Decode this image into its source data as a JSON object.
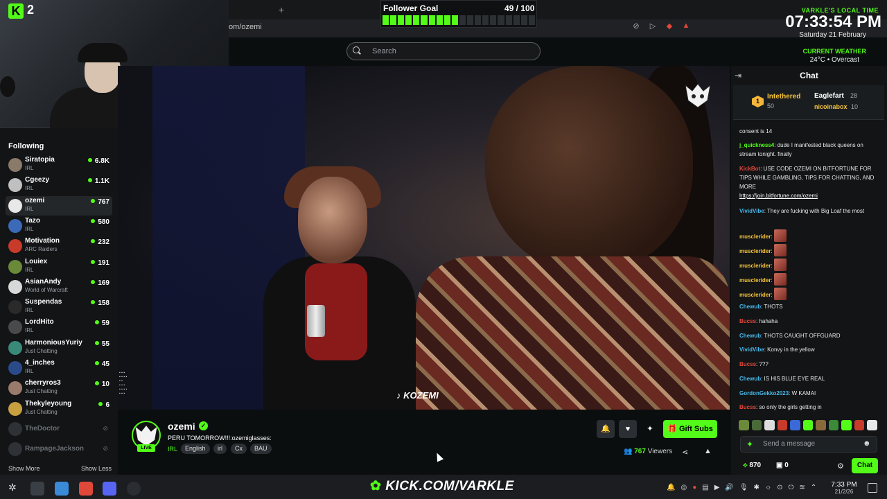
{
  "browser": {
    "url": "om/ozemi",
    "new_tab": "+"
  },
  "header": {
    "search_placeholder": "Search"
  },
  "overlay": {
    "badge_number": "2",
    "goal_title": "Follower Goal",
    "goal_count": "49 / 100",
    "goal_progress": 0.49,
    "time_label": "VARKLE'S LOCAL TIME",
    "time": "07:33:54 PM",
    "date": "Saturday 21 February",
    "weather_label": "CURRENT WEATHER",
    "weather": "24°C • Overcast"
  },
  "sidebar": {
    "title": "Following",
    "items": [
      {
        "name": "Siratopia",
        "category": "IRL",
        "viewers": "6.8K",
        "color": "#8a7a6a"
      },
      {
        "name": "Cgeezy",
        "category": "IRL",
        "viewers": "1.1K",
        "color": "#c0c0c0"
      },
      {
        "name": "ozemi",
        "category": "IRL",
        "viewers": "767",
        "color": "#e8e8e8"
      },
      {
        "name": "Tazo",
        "category": "IRL",
        "viewers": "580",
        "color": "#3a6ab8"
      },
      {
        "name": "Motivation",
        "category": "ARC Raiders",
        "viewers": "232",
        "color": "#c83a2a"
      },
      {
        "name": "Louiex",
        "category": "IRL",
        "viewers": "191",
        "color": "#6a8a3a"
      },
      {
        "name": "AsianAndy",
        "category": "World of Warcraft",
        "viewers": "169",
        "color": "#d8d8d8"
      },
      {
        "name": "Suspendas",
        "category": "IRL",
        "viewers": "158",
        "color": "#2a2a2a"
      },
      {
        "name": "LordHito",
        "category": "IRL",
        "viewers": "59",
        "color": "#4a4a4a"
      },
      {
        "name": "HarmoniousYuriy",
        "category": "Just Chatting",
        "viewers": "55",
        "color": "#3a8a7a"
      },
      {
        "name": "4_inches",
        "category": "IRL",
        "viewers": "45",
        "color": "#2a4a8a"
      },
      {
        "name": "cherryros3",
        "category": "Just Chatting",
        "viewers": "10",
        "color": "#9a7a6a"
      },
      {
        "name": "Thekyleyoung",
        "category": "Just Chatting",
        "viewers": "6",
        "color": "#c8a040"
      }
    ],
    "offline": [
      "TheDoctor",
      "RampageJackson"
    ],
    "show_more": "Show More",
    "show_less": "Show Less"
  },
  "video": {
    "watermark": "KOZEMI"
  },
  "stream": {
    "channel": "ozemi",
    "live": "LIVE",
    "title": "PERU TOMORROW!!!:ozemiglasses:",
    "category": "IRL",
    "tags": [
      "English",
      "irl",
      "Cx",
      "BAU"
    ],
    "gift_subs": "Gift Subs",
    "viewers_count": "767",
    "viewers_label": "Viewers"
  },
  "chat": {
    "title": "Chat",
    "leaderboard": [
      {
        "rank": "1",
        "name": "Intethered",
        "value": "50"
      },
      {
        "name": "Eaglefart",
        "value": "28"
      },
      {
        "name": "nicoinabox",
        "value": "10"
      }
    ],
    "messages": [
      {
        "user": "",
        "text": "consent is 14",
        "color": "#e8e8e8"
      },
      {
        "user": "j_quickness4",
        "text": ": dude I manifested black queens on stream tonight. finally",
        "color": "#53fc18"
      },
      {
        "user": "KickBot",
        "text": ": USE CODE OZEMI ON BITFORTUNE FOR TIPS WHILE GAMBLING, TIPS FOR CHATTING, AND MORE",
        "link": "https://join.bitfortune.com/ozemi",
        "color": "#e0483a"
      },
      {
        "user": "VividVibe",
        "text": ": They are fucking with Big Loaf the most",
        "color": "#4ab8e8"
      },
      {
        "user": "musclerider",
        "text": ":",
        "emote": true,
        "color": "#f5c33b"
      },
      {
        "user": "musclerider",
        "text": ":",
        "emote": true,
        "color": "#f5c33b"
      },
      {
        "user": "musclerider",
        "text": ":",
        "emote": true,
        "color": "#f5c33b"
      },
      {
        "user": "musclerider",
        "text": ":",
        "emote": true,
        "color": "#f5c33b"
      },
      {
        "user": "musclerider",
        "text": ":",
        "emote": true,
        "color": "#f5c33b"
      },
      {
        "user": "Chewub",
        "text": ": THOTS",
        "color": "#4ab8e8"
      },
      {
        "user": "Bucss",
        "text": ": hahaha",
        "color": "#e0483a"
      },
      {
        "user": "Chewub",
        "text": ": THOTS CAUGHT OFFGUARD",
        "color": "#4ab8e8"
      },
      {
        "user": "VividVibe",
        "text": ": Konvy in the yellow",
        "color": "#4ab8e8"
      },
      {
        "user": "Bucss",
        "text": ": ???",
        "color": "#e0483a"
      },
      {
        "user": "Chewub",
        "text": ": IS HIS BLUE EYE REAL",
        "color": "#4ab8e8"
      },
      {
        "user": "GordonGekko2023",
        "text": ": W KAMAI",
        "color": "#4ab8e8"
      },
      {
        "user": "Bucss",
        "text": ": so only the girls getting in",
        "color": "#e0483a"
      }
    ],
    "input_placeholder": "Send a message",
    "points": "870",
    "points2": "0",
    "chat_button": "Chat"
  },
  "taskbar": {
    "brand": "KICK.COM/VARKLE",
    "clock_time": "7:33 PM",
    "clock_date": "21/2/26"
  }
}
